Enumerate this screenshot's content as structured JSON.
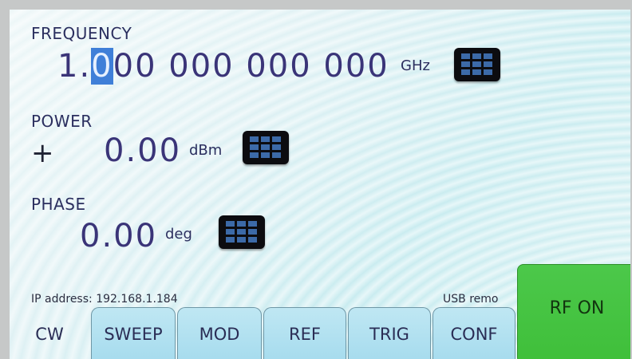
{
  "frequency": {
    "label": "FREQUENCY",
    "value_lead": "1.",
    "value_cursor": "0",
    "value_rest": "00 000 000 000",
    "unit": "GHz"
  },
  "power": {
    "label": "POWER",
    "sign": "+",
    "value": "0.00",
    "unit": "dBm"
  },
  "phase": {
    "label": "PHASE",
    "value": "0.00",
    "unit": "deg"
  },
  "status": {
    "ip": "IP address: 192.168.1.184",
    "usb": "USB remo"
  },
  "tabs": [
    {
      "label": "CW"
    },
    {
      "label": "SWEEP"
    },
    {
      "label": "MOD"
    },
    {
      "label": "REF"
    },
    {
      "label": "TRIG"
    },
    {
      "label": "CONF"
    }
  ],
  "rf_button": {
    "label": "RF ON"
  },
  "icons": {
    "keypad": "keypad-icon"
  },
  "colors": {
    "value_text": "#3a3478",
    "cursor": "#3f7fd8",
    "rf_on": "#45c342",
    "tab": "#b3e2f1"
  }
}
